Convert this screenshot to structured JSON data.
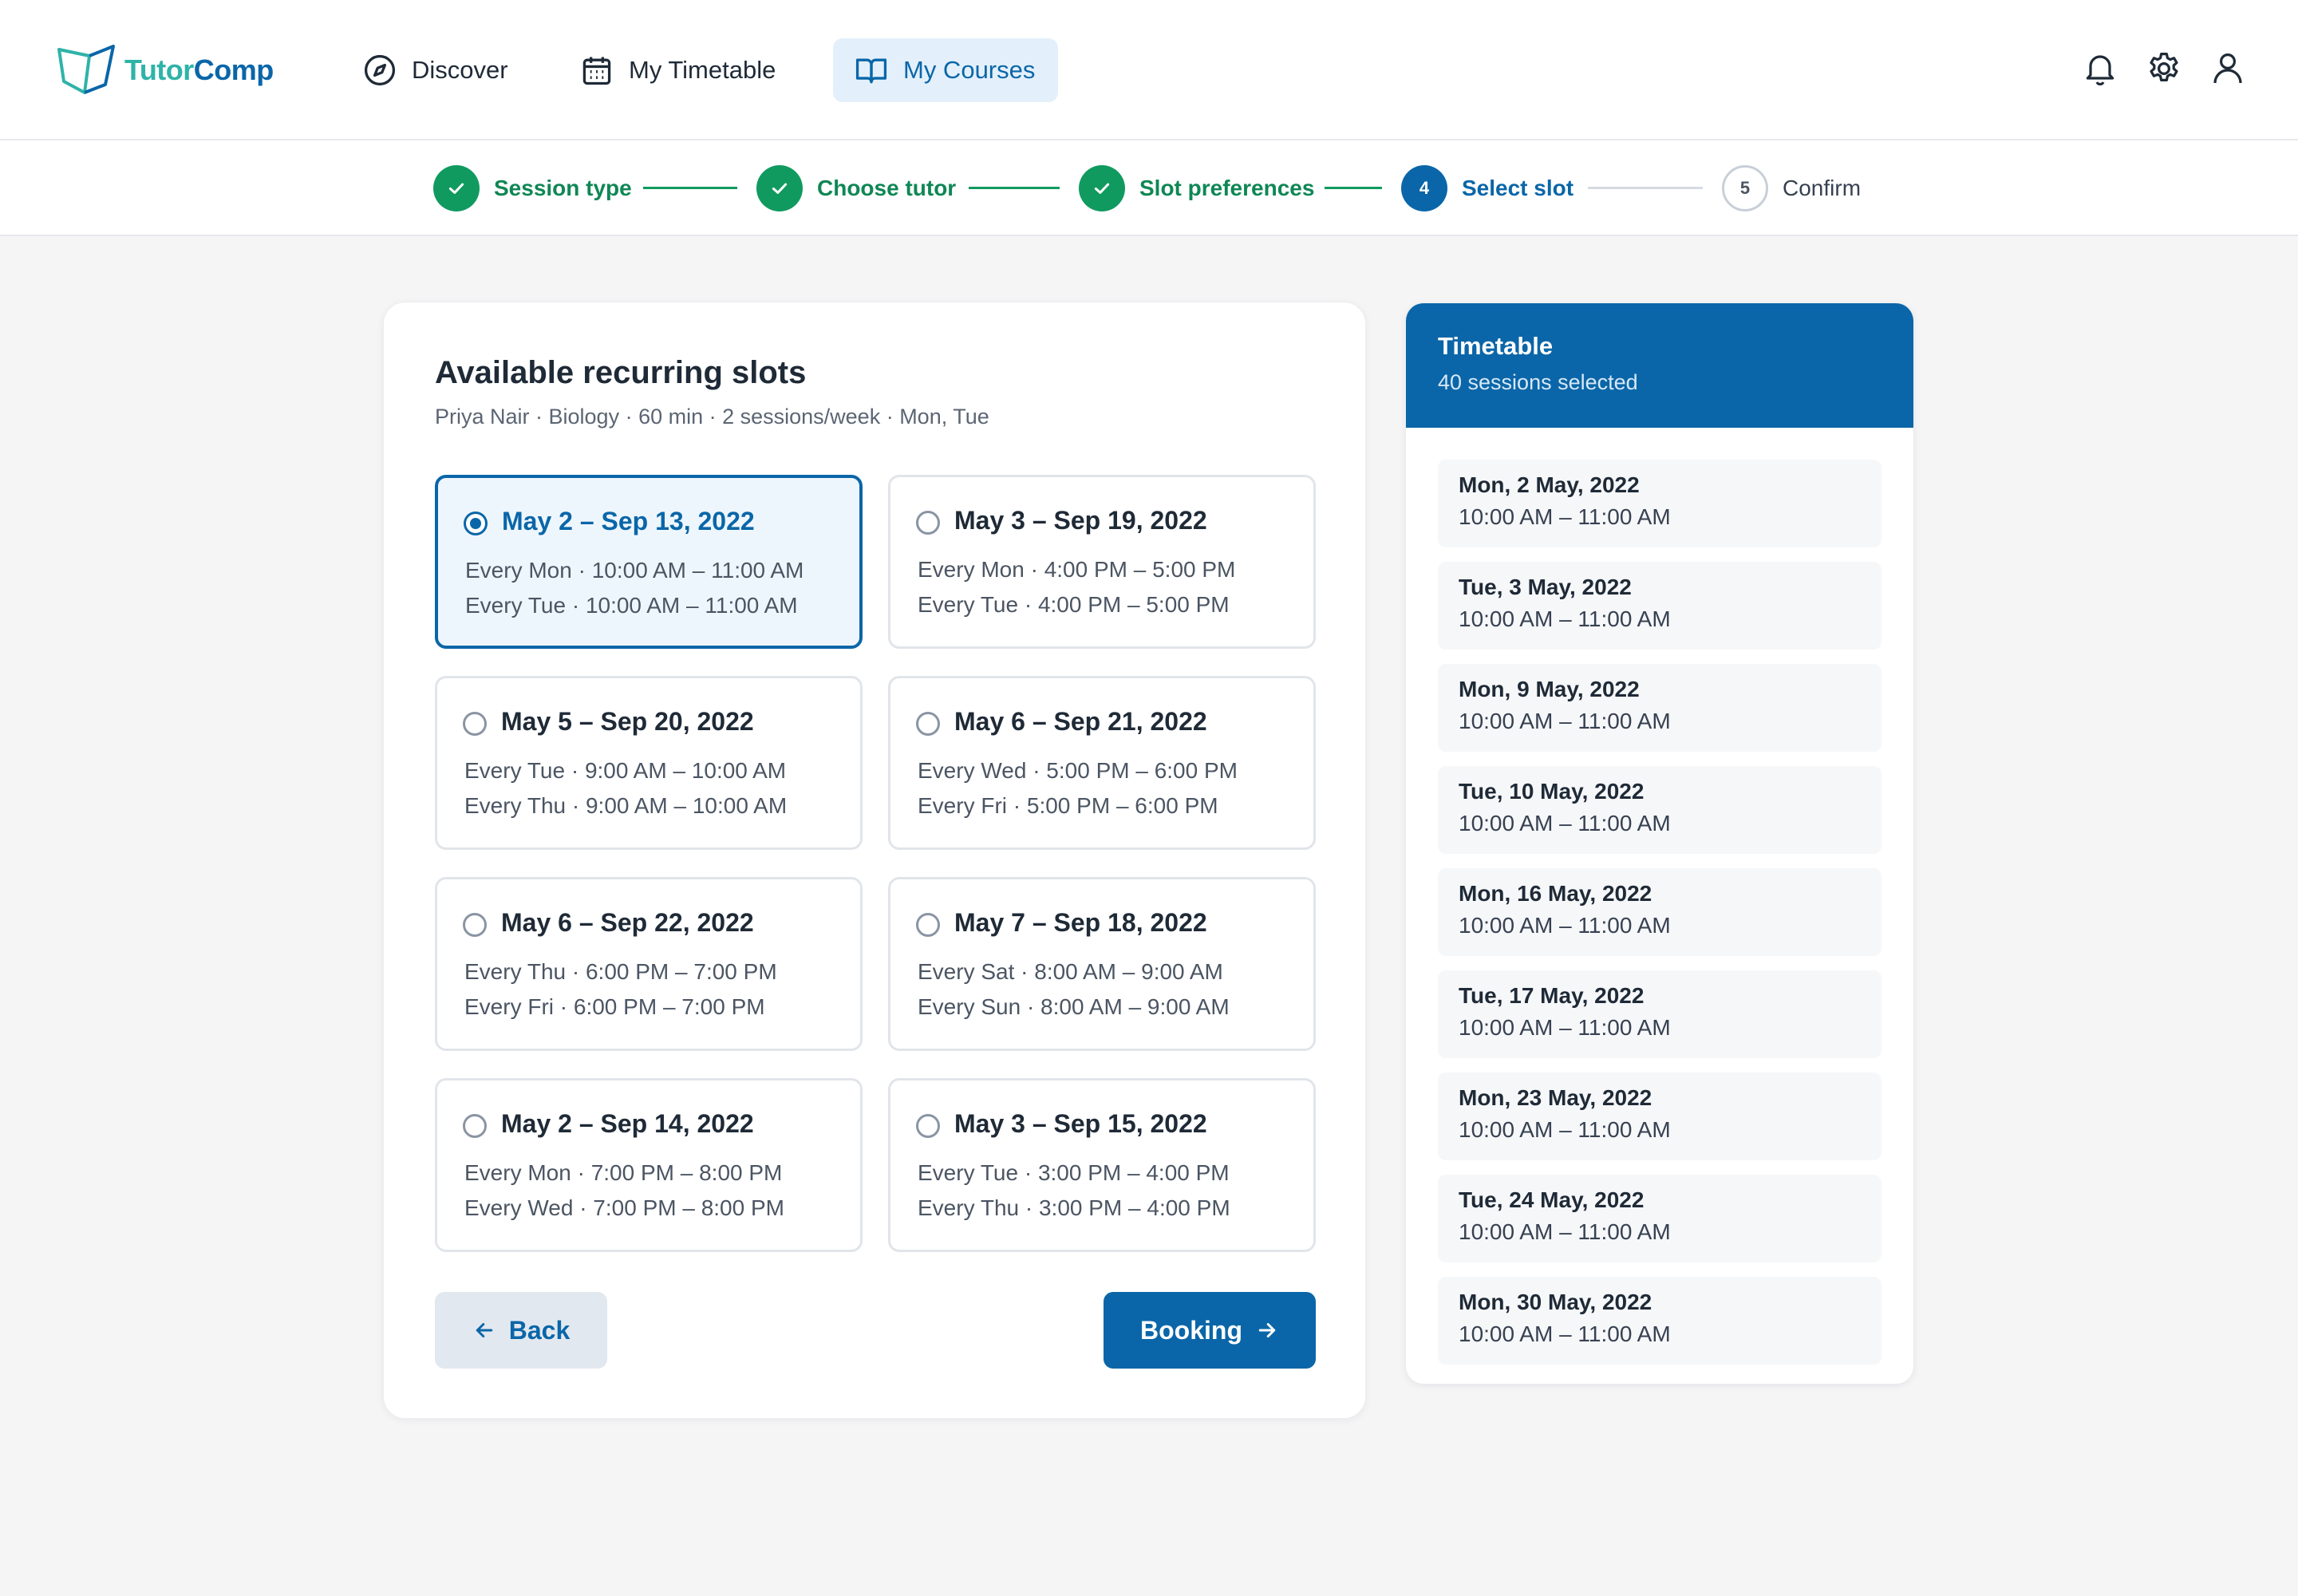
{
  "app": {
    "logo_part1": "Tutor",
    "logo_part2": "Comp"
  },
  "nav": {
    "discover": "Discover",
    "timetable": "My Timetable",
    "courses": "My Courses"
  },
  "stepper": {
    "steps": [
      {
        "label": "Session type",
        "status": "done"
      },
      {
        "label": "Choose tutor",
        "status": "done"
      },
      {
        "label": "Slot preferences",
        "status": "done"
      },
      {
        "label": "Select slot",
        "number": "4",
        "status": "current"
      },
      {
        "label": "Confirm",
        "number": "5",
        "status": "todo"
      }
    ]
  },
  "main": {
    "title": "Available recurring slots",
    "subtitle": "Priya Nair · Biology · 60 min · 2 sessions/week · Mon, Tue",
    "slots": [
      {
        "range": "May 2 – Sep 13, 2022",
        "line1": "Every Mon · 10:00 AM – 11:00 AM",
        "line2": "Every Tue · 10:00 AM – 11:00 AM",
        "selected": true
      },
      {
        "range": "May 3 – Sep 19, 2022",
        "line1": "Every Mon · 4:00 PM – 5:00 PM",
        "line2": "Every Tue · 4:00 PM – 5:00 PM",
        "selected": false
      },
      {
        "range": "May 5 – Sep 20, 2022",
        "line1": "Every Tue · 9:00 AM – 10:00 AM",
        "line2": "Every Thu · 9:00 AM – 10:00 AM",
        "selected": false
      },
      {
        "range": "May 6 – Sep 21, 2022",
        "line1": "Every Wed · 5:00 PM – 6:00 PM",
        "line2": "Every Fri · 5:00 PM – 6:00 PM",
        "selected": false
      },
      {
        "range": "May 6 – Sep 22, 2022",
        "line1": "Every Thu · 6:00 PM – 7:00 PM",
        "line2": "Every Fri · 6:00 PM – 7:00 PM",
        "selected": false
      },
      {
        "range": "May 7 – Sep 18, 2022",
        "line1": "Every Sat · 8:00 AM – 9:00 AM",
        "line2": "Every Sun · 8:00 AM – 9:00 AM",
        "selected": false
      },
      {
        "range": "May 2 – Sep 14, 2022",
        "line1": "Every Mon · 7:00 PM – 8:00 PM",
        "line2": "Every Wed · 7:00 PM – 8:00 PM",
        "selected": false
      },
      {
        "range": "May 3 – Sep 15, 2022",
        "line1": "Every Tue · 3:00 PM – 4:00 PM",
        "line2": "Every Thu · 3:00 PM – 4:00 PM",
        "selected": false
      }
    ],
    "back_label": "Back",
    "booking_label": "Booking"
  },
  "timetable": {
    "title": "Timetable",
    "count": "40 sessions selected",
    "items": [
      {
        "date": "Mon, 2 May, 2022",
        "time": "10:00 AM – 11:00 AM"
      },
      {
        "date": "Tue, 3 May, 2022",
        "time": "10:00 AM – 11:00 AM"
      },
      {
        "date": "Mon, 9 May, 2022",
        "time": "10:00 AM – 11:00 AM"
      },
      {
        "date": "Tue, 10 May, 2022",
        "time": "10:00 AM – 11:00 AM"
      },
      {
        "date": "Mon, 16 May, 2022",
        "time": "10:00 AM – 11:00 AM"
      },
      {
        "date": "Tue, 17 May, 2022",
        "time": "10:00 AM – 11:00 AM"
      },
      {
        "date": "Mon, 23 May, 2022",
        "time": "10:00 AM – 11:00 AM"
      },
      {
        "date": "Tue, 24 May, 2022",
        "time": "10:00 AM – 11:00 AM"
      },
      {
        "date": "Mon, 30 May, 2022",
        "time": "10:00 AM – 11:00 AM"
      }
    ]
  },
  "colors": {
    "primary": "#0a66a8",
    "success": "#109a5f",
    "brand_teal": "#2fb3a8",
    "background": "#f5f5f6"
  },
  "icons": {
    "discover": "compass-icon",
    "timetable": "calendar-icon",
    "courses": "book-open-icon",
    "notifications": "bell-icon",
    "settings": "gear-icon",
    "account": "user-icon"
  }
}
